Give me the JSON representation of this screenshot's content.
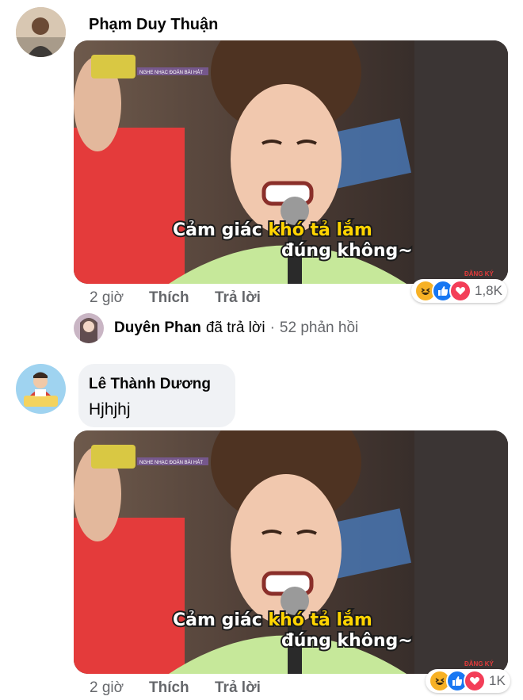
{
  "comments": [
    {
      "author": "Phạm Duy Thuận",
      "time": "2 giờ",
      "like_label": "Thích",
      "reply_label": "Trả lời",
      "reaction_count": "1,8K",
      "reactions": [
        "haha-icon",
        "like-icon",
        "love-icon"
      ],
      "image": {
        "show_tag": "NGHE NHẠC ĐOÁN BÀI HÁT",
        "caption_line1_a": "Cảm giác ",
        "caption_line1_b": "khó tả lắm",
        "caption_line2": "đúng không~",
        "subscribe": "ĐĂNG KÝ"
      },
      "reply_summary": {
        "replier": "Duyên Phan",
        "action": "đã trả lời",
        "separator": "·",
        "count": "52 phản hồi"
      }
    },
    {
      "author": "Lê Thành Dương",
      "text": "Hjhjhj",
      "time": "2 giờ",
      "like_label": "Thích",
      "reply_label": "Trả lời",
      "reaction_count": "1K",
      "reactions": [
        "haha-icon",
        "like-icon",
        "love-icon"
      ],
      "image": {
        "show_tag": "NGHE NHẠC ĐOÁN BÀI HÁT",
        "caption_line1_a": "Cảm giác ",
        "caption_line1_b": "khó tả lắm",
        "caption_line2": "đúng không~",
        "subscribe": "ĐĂNG KÝ"
      }
    }
  ],
  "colors": {
    "name": "#050505",
    "meta": "#65676b",
    "bubble": "#f0f2f5",
    "caption_white": "#ffffff",
    "caption_yellow": "#ffd400",
    "like_blue": "#1877f2",
    "love_red": "#f33e58",
    "haha_yellow": "#f7b125"
  }
}
